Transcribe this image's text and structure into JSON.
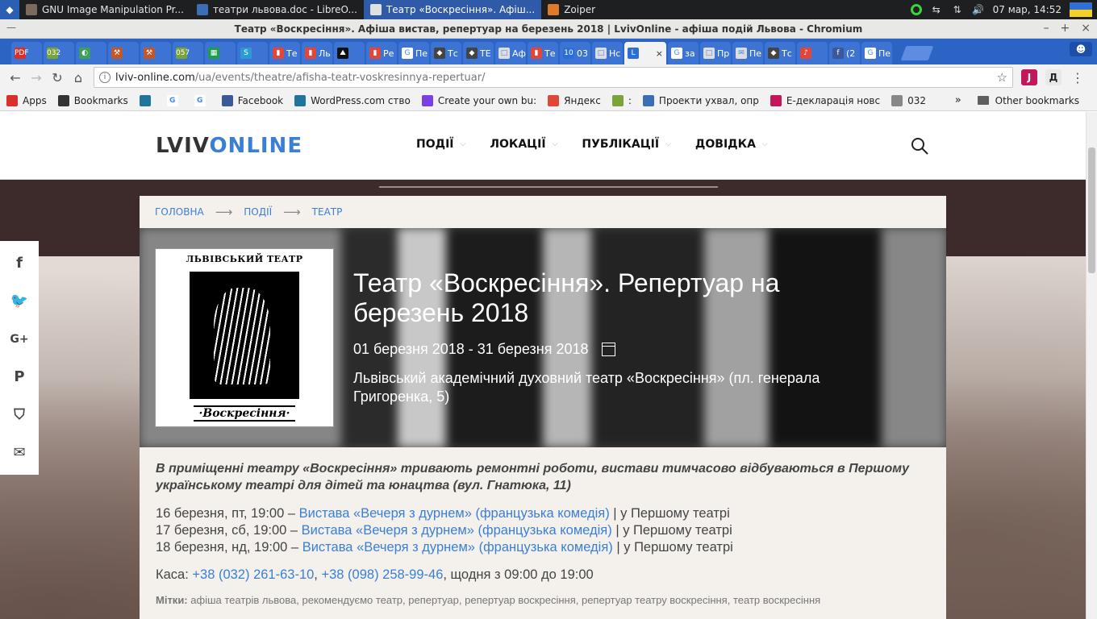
{
  "os": {
    "tasks": [
      {
        "label": "GNU Image Manipulation Pr...",
        "color": "#7c6b5a"
      },
      {
        "label": "театри львова.doc - LibreO...",
        "color": "#3b6fb5"
      },
      {
        "label": "Театр «Воскресіння». Афіш...",
        "color": "#e0e0e0",
        "active": true
      },
      {
        "label": "Zoiper",
        "color": "#e07a2b"
      }
    ],
    "clock": "07 мар, 14:52"
  },
  "window": {
    "title": "Театр «Воскресіння». Афіша вистав, репертуар на березень 2018 | LvivOnline - афіша подій Львова - Chromium",
    "buttons": [
      "–",
      "+",
      "×"
    ]
  },
  "tabs": [
    {
      "label": "",
      "fav": "PDF",
      "color": "#d9302c"
    },
    {
      "label": "",
      "fav": "032",
      "color": "#7aa33a"
    },
    {
      "label": "",
      "fav": "◐",
      "color": "#3aa05a"
    },
    {
      "label": "",
      "fav": "⚒",
      "color": "#c0582b"
    },
    {
      "label": "",
      "fav": "⚒",
      "color": "#c0582b"
    },
    {
      "label": "",
      "fav": "057",
      "color": "#7aa33a"
    },
    {
      "label": "",
      "fav": "▦",
      "color": "#1e9e4a"
    },
    {
      "label": "",
      "fav": "S",
      "color": "#2b9bd6"
    },
    {
      "label": "Те",
      "fav": "▮",
      "color": "#e0463a"
    },
    {
      "label": "Ль",
      "fav": "▮",
      "color": "#e0463a"
    },
    {
      "label": "",
      "fav": "⛰",
      "color": "#111111"
    },
    {
      "label": "Ре",
      "fav": "▮",
      "color": "#e0463a"
    },
    {
      "label": "Пе",
      "fav": "G",
      "color": "#ffffff"
    },
    {
      "label": "Тс",
      "fav": "◆",
      "color": "#444444"
    },
    {
      "label": "ТЕ",
      "fav": "◆",
      "color": "#444444"
    },
    {
      "label": "Аф",
      "fav": "□",
      "color": "#dddddd"
    },
    {
      "label": "Те",
      "fav": "▮",
      "color": "#e0463a"
    },
    {
      "label": "03",
      "fav": "10",
      "color": "#2b6fd6"
    },
    {
      "label": "Нс",
      "fav": "□",
      "color": "#dddddd"
    },
    {
      "label": "",
      "fav": "L",
      "color": "#2b6fd6",
      "active": true
    },
    {
      "label": "за",
      "fav": "G",
      "color": "#ffffff"
    },
    {
      "label": "Пр",
      "fav": "□",
      "color": "#dddddd"
    },
    {
      "label": "Пе",
      "fav": "✉",
      "color": "#dddddd"
    },
    {
      "label": "Тс",
      "fav": "◆",
      "color": "#444444"
    },
    {
      "label": "",
      "fav": "♪",
      "color": "#e0463a"
    },
    {
      "label": "(2",
      "fav": "f",
      "color": "#3b5998"
    },
    {
      "label": "Пе",
      "fav": "G",
      "color": "#ffffff"
    }
  ],
  "toolbar": {
    "url_domain": "lviv-online.com",
    "url_path": "/ua/events/theatre/afisha-teatr-voskresinnya-repertuar/",
    "extensions": [
      {
        "label": "J",
        "color": "#c2185b"
      },
      {
        "label": "Д",
        "color": "#e8e8e8"
      }
    ]
  },
  "bookmarks": {
    "items": [
      {
        "label": "Apps",
        "icon": "apps-icon",
        "color": "#d9302c"
      },
      {
        "label": "Bookmarks",
        "icon": "star-icon",
        "color": "#333333"
      },
      {
        "label": "",
        "icon": "wordpress-icon",
        "color": "#21759b"
      },
      {
        "label": "",
        "icon": "google-icon",
        "color": "#ffffff"
      },
      {
        "label": "",
        "icon": "google-icon",
        "color": "#ffffff"
      },
      {
        "label": "Facebook",
        "icon": "facebook-icon",
        "color": "#3b5998"
      },
      {
        "label": "WordPress.com ство",
        "icon": "wordpress-icon",
        "color": "#21759b"
      },
      {
        "label": "Create your own bu:",
        "icon": "create-icon",
        "color": "#7b3fe4"
      },
      {
        "label": "Яндекс",
        "icon": "yandex-icon",
        "color": "#e0463a"
      },
      {
        "label": ":",
        "icon": "032-icon",
        "color": "#7aa33a"
      },
      {
        "label": "Проекти ухвал, опр",
        "icon": "crest-icon",
        "color": "#3b6fb5"
      },
      {
        "label": "Е-декларація новс",
        "icon": "edecl-icon",
        "color": "#c2185b"
      },
      {
        "label": "032",
        "icon": "b-icon",
        "color": "#888888"
      }
    ],
    "more": "»",
    "other": "Other bookmarks"
  },
  "site": {
    "logo_part1": "LVIV",
    "logo_part2": "ONLINE",
    "menu": [
      "ПОДІЇ",
      "ЛОКАЦІЇ",
      "ПУБЛІКАЦІЇ",
      "ДОВІДКА"
    ]
  },
  "breadcrumb": [
    "ГОЛОВНА",
    "ПОДІЇ",
    "ТЕАТР"
  ],
  "poster": {
    "top_text": "ЛЬВІВСЬКИЙ ТЕАТР",
    "bottom_text": "·Воскресіння·"
  },
  "event": {
    "title": "Театр «Воскресіння». Репертуар на березень 2018",
    "dates": "01 березня 2018 - 31 березня 2018",
    "venue": "Львівський академічний духовний театр «Воскресіння» (пл. генерала Григоренка, 5)",
    "notice": "В приміщенні театру «Воскресіння» тривають ремонтні роботи, вистави тимчасово відбуваються в Першому українському театрі для дітей та юнацтва (вул. Гнатюка, 11)",
    "shows": [
      {
        "when": "16 березня, пт, 19:00 – ",
        "link": "Вистава «Вечеря з дурнем» (французька комедія)",
        "where": " | у Першому театрі"
      },
      {
        "when": "17 березня, сб, 19:00 – ",
        "link": "Вистава «Вечеря з дурнем» (французька комедія)",
        "where": " | у Першому театрі"
      },
      {
        "when": "18 березня, нд, 19:00 – ",
        "link": "Вистава «Вечеря з дурнем» (французька комедія)",
        "where": " | у Першому театрі"
      }
    ],
    "kasa_label": "Каса: ",
    "phone1": "+38 (032) 261-63-10",
    "phone_sep": ", ",
    "phone2": "+38 (098) 258-99-46",
    "kasa_hours": ", щодня з 09:00 до 19:00",
    "tags_label": "Мітки:",
    "tags": [
      "афіша театрів львова",
      "рекомендуємо театр",
      "репертуар",
      "репертуар воскресіння",
      "репертуар театру воскресіння",
      "театр воскресіння"
    ]
  },
  "share": [
    "facebook-icon",
    "twitter-icon",
    "google-plus-icon",
    "pinterest-icon",
    "pocket-icon",
    "email-icon"
  ],
  "colors": {
    "accent": "#3a7fd5",
    "tab_strip": "#2c64c6"
  }
}
